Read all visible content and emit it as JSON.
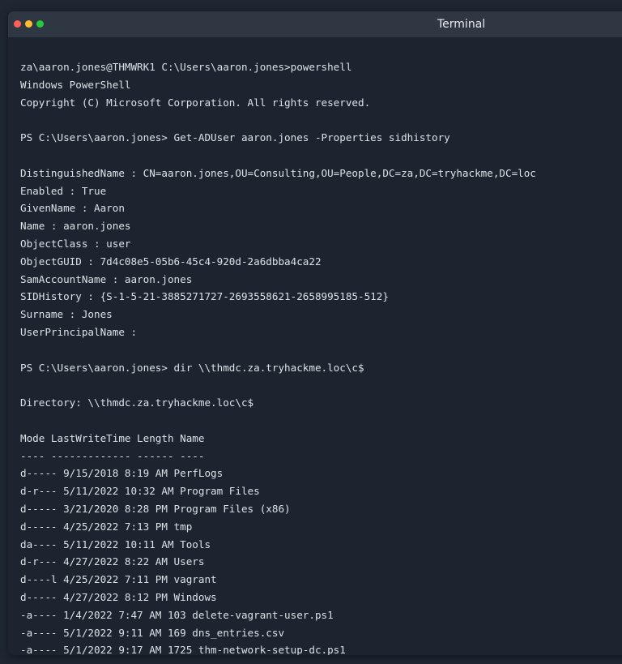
{
  "window": {
    "title": "Terminal",
    "controls": {
      "close_color": "#ff5f56",
      "minimize_color": "#ffbd2e",
      "maximize_color": "#27c93f"
    }
  },
  "terminal": {
    "lines": [
      "za\\aaron.jones@THMWRK1 C:\\Users\\aaron.jones>powershell",
      "Windows PowerShell",
      "Copyright (C) Microsoft Corporation. All rights reserved.",
      "",
      "PS C:\\Users\\aaron.jones> Get-ADUser aaron.jones -Properties sidhistory",
      "",
      "DistinguishedName : CN=aaron.jones,OU=Consulting,OU=People,DC=za,DC=tryhackme,DC=loc",
      "Enabled : True",
      "GivenName : Aaron",
      "Name : aaron.jones",
      "ObjectClass : user",
      "ObjectGUID : 7d4c08e5-05b6-45c4-920d-2a6dbba4ca22",
      "SamAccountName : aaron.jones",
      "SIDHistory : {S-1-5-21-3885271727-2693558621-2658995185-512}",
      "Surname : Jones",
      "UserPrincipalName :",
      "",
      "PS C:\\Users\\aaron.jones> dir \\\\thmdc.za.tryhackme.loc\\c$",
      "",
      "Directory: \\\\thmdc.za.tryhackme.loc\\c$",
      "",
      "Mode LastWriteTime Length Name",
      "---- ------------- ------ ----",
      "d----- 9/15/2018 8:19 AM PerfLogs",
      "d-r--- 5/11/2022 10:32 AM Program Files",
      "d----- 3/21/2020 8:28 PM Program Files (x86)",
      "d----- 4/25/2022 7:13 PM tmp",
      "da---- 5/11/2022 10:11 AM Tools",
      "d-r--- 4/27/2022 8:22 AM Users",
      "d----l 4/25/2022 7:11 PM vagrant",
      "d----- 4/27/2022 8:12 PM Windows",
      "-a---- 1/4/2022 7:47 AM 103 delete-vagrant-user.ps1",
      "-a---- 5/1/2022 9:11 AM 169 dns_entries.csv",
      "-a---- 5/1/2022 9:17 AM 1725 thm-network-setup-dc.ps1"
    ]
  }
}
